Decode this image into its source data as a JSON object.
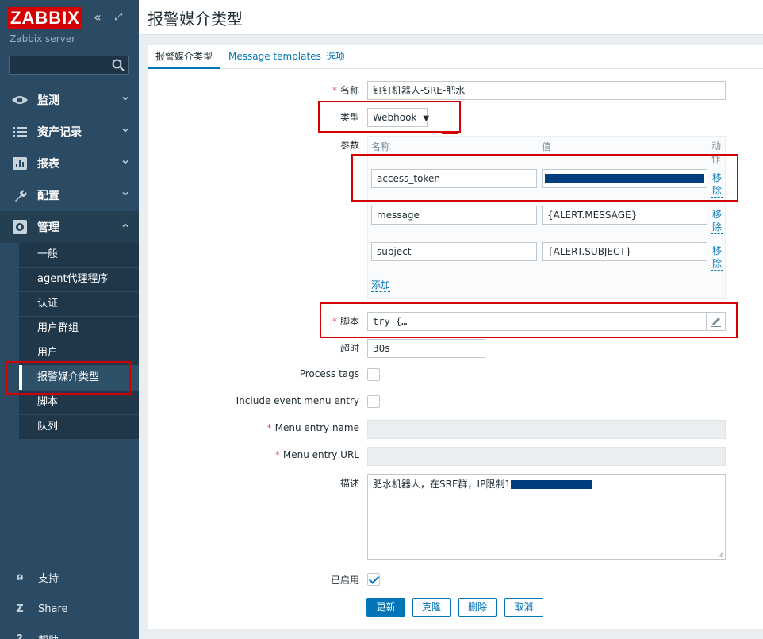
{
  "sidebar": {
    "logo": "ZABBIX",
    "collapse_glyph": "«",
    "kiosk_glyph": "⤢",
    "server_name": "Zabbix server",
    "search": {
      "placeholder": "",
      "value": ""
    },
    "menu": [
      {
        "label": "监测",
        "icon": "eye-icon"
      },
      {
        "label": "资产记录",
        "icon": "list-icon"
      },
      {
        "label": "报表",
        "icon": "bar-chart-icon"
      },
      {
        "label": "配置",
        "icon": "wrench-icon"
      },
      {
        "label": "管理",
        "icon": "gear-icon"
      }
    ],
    "admin_submenu": [
      "一般",
      "agent代理程序",
      "认证",
      "用户群组",
      "用户",
      "报警媒介类型",
      "脚本",
      "队列"
    ],
    "bottom": [
      {
        "label": "支持",
        "icon": "headset-icon",
        "glyph": "ɷ"
      },
      {
        "label": "Share",
        "icon": "share-z-icon",
        "glyph": "Z"
      },
      {
        "label": "帮助",
        "icon": "help-icon",
        "glyph": "?"
      }
    ]
  },
  "header": {
    "title": "报警媒介类型"
  },
  "tabs": [
    "报警媒介类型",
    "Message templates",
    "选项"
  ],
  "form": {
    "name_label": "名称",
    "name_value": "钉钉机器人-SRE-肥水",
    "type_label": "类型",
    "type_value": "Webhook",
    "params_label": "参数",
    "params_header_name": "名称",
    "params_header_value": "值",
    "params_header_action": "动作",
    "params": [
      {
        "name": "access_token",
        "value": ""
      },
      {
        "name": "message",
        "value": "{ALERT.MESSAGE}"
      },
      {
        "name": "subject",
        "value": "{ALERT.SUBJECT}"
      }
    ],
    "remove_label": "移除",
    "add_label": "添加",
    "script_label": "脚本",
    "script_value": "try {…",
    "timeout_label": "超时",
    "timeout_value": "30s",
    "process_tags_label": "Process tags",
    "include_menu_label": "Include event menu entry",
    "menu_entry_name_label": "Menu entry name",
    "menu_entry_url_label": "Menu entry URL",
    "description_label": "描述",
    "description_value": "肥水机器人，在SRE群，IP限制1",
    "enabled_label": "已启用",
    "buttons": {
      "update": "更新",
      "clone": "克隆",
      "delete": "删除",
      "cancel": "取消"
    }
  },
  "colors": {
    "sidebar_bg": "#2b4a63",
    "accent": "#0275b8",
    "highlight": "#d40000",
    "redaction": "#003f7f"
  }
}
